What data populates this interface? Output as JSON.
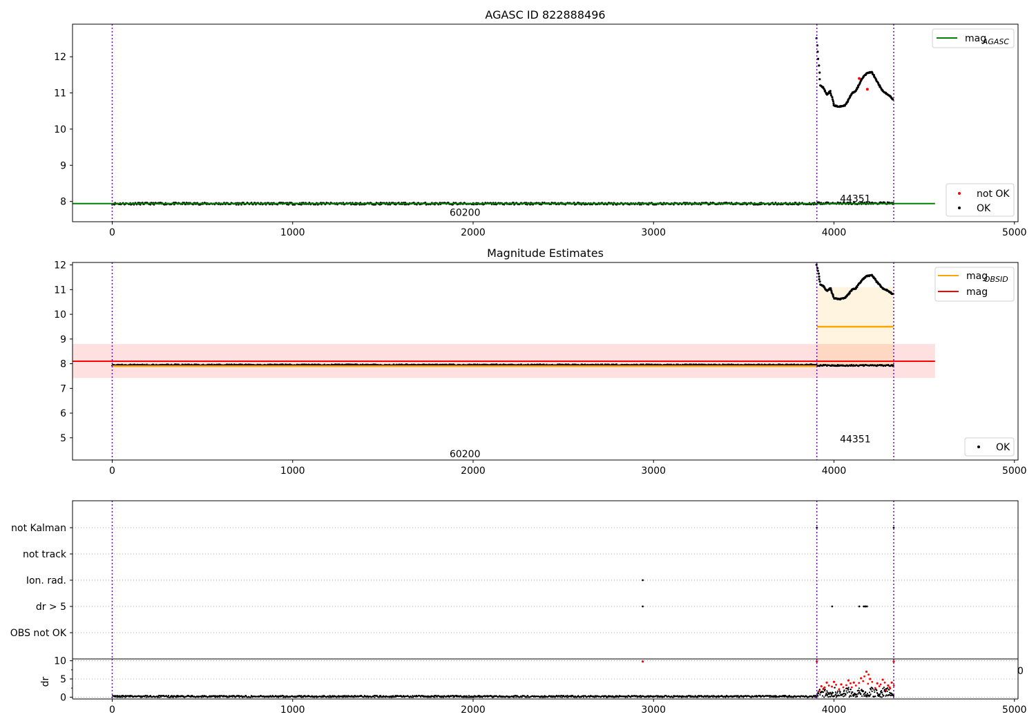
{
  "chart_data": [
    {
      "type": "scatter",
      "title": "AGASC ID 822888496",
      "xlim": [
        -220,
        5020
      ],
      "ylim": [
        7.44,
        12.9
      ],
      "x_ticks": [
        0,
        1000,
        2000,
        3000,
        4000,
        5000
      ],
      "y_ticks": [
        8,
        9,
        10,
        11,
        12
      ],
      "grid": false,
      "legend_upper": {
        "placement": "top-right",
        "entries": [
          {
            "label": "mag",
            "subscript": "AGASC",
            "color": "#008000"
          }
        ]
      },
      "legend_lower": {
        "placement": "bottom-right",
        "entries": [
          {
            "label": "not OK",
            "color": "#ff0000"
          },
          {
            "label": "OK",
            "color": "#000000"
          }
        ]
      },
      "reference_line": {
        "y": 7.94,
        "x_range": [
          -220,
          4560
        ],
        "color": "#008000"
      },
      "obsid_boundaries": [
        0,
        3905,
        4331
      ],
      "obsid_labels": [
        {
          "text": "60200",
          "x": 1955,
          "y": 7.7
        },
        {
          "text": "44351",
          "x": 4118,
          "y": 8.08
        }
      ],
      "series": [
        {
          "name": "OK",
          "color": "#000000",
          "segments": [
            {
              "x": [
                0,
                3905
              ],
              "y": 7.94
            },
            {
              "x": [
                3905,
                3925,
                3940,
                3960,
                3980,
                4000,
                4030,
                4060,
                4080,
                4100,
                4120,
                4150,
                4180,
                4210,
                4240,
                4270,
                4300,
                4331
              ],
              "y": [
                12.5,
                11.2,
                11.15,
                10.95,
                11.05,
                10.65,
                10.62,
                10.65,
                10.8,
                11.0,
                11.05,
                11.35,
                11.55,
                11.58,
                11.3,
                11.05,
                10.95,
                10.8
              ]
            },
            {
              "x": [
                3905,
                4331
              ],
              "y": 7.95
            }
          ]
        },
        {
          "name": "not OK",
          "color": "#ff0000",
          "points": [
            {
              "x": 4140,
              "y": 11.4
            },
            {
              "x": 4185,
              "y": 11.1
            }
          ]
        }
      ]
    },
    {
      "type": "scatter",
      "title": "Magnitude Estimates",
      "xlim": [
        -220,
        5020
      ],
      "ylim": [
        4.1,
        12.1
      ],
      "x_ticks": [
        0,
        1000,
        2000,
        3000,
        4000,
        5000
      ],
      "y_ticks": [
        5,
        6,
        7,
        8,
        9,
        10,
        11,
        12
      ],
      "grid": false,
      "legend_upper": {
        "placement": "top-right",
        "entries": [
          {
            "label": "mag",
            "subscript": "OBSID",
            "color": "#ffa500"
          },
          {
            "label": "mag",
            "subscript": "",
            "color": "#ff0000"
          }
        ]
      },
      "legend_lower": {
        "placement": "bottom-right",
        "entries": [
          {
            "label": "OK",
            "color": "#000000"
          }
        ]
      },
      "overall_mag": {
        "y": 8.1,
        "band": [
          7.42,
          8.8
        ],
        "x_range": [
          -220,
          4560
        ],
        "color": "#ff0000"
      },
      "obsid_mag": [
        {
          "x_range": [
            0,
            3905
          ],
          "y": 7.9
        },
        {
          "x_range": [
            3905,
            4331
          ],
          "y": 9.5,
          "band": [
            7.9,
            11.1
          ]
        }
      ],
      "obsid_boundaries": [
        0,
        3905,
        4331
      ],
      "obsid_labels": [
        {
          "text": "60200",
          "x": 1955,
          "y": 4.35
        },
        {
          "text": "44351",
          "x": 4118,
          "y": 4.95
        }
      ],
      "series": [
        {
          "name": "OK",
          "color": "#000000",
          "segments": [
            {
              "x": [
                0,
                3905
              ],
              "y": 7.95
            },
            {
              "x": [
                3905,
                3925,
                3940,
                3960,
                3980,
                4000,
                4030,
                4060,
                4080,
                4100,
                4120,
                4150,
                4180,
                4210,
                4240,
                4270,
                4300,
                4331
              ],
              "y": [
                12.0,
                11.2,
                11.15,
                10.95,
                11.05,
                10.65,
                10.62,
                10.65,
                10.8,
                11.0,
                11.05,
                11.35,
                11.55,
                11.58,
                11.3,
                11.05,
                10.95,
                10.8
              ]
            },
            {
              "x": [
                3905,
                4331
              ],
              "y": 7.93
            }
          ]
        }
      ]
    },
    {
      "type": "scatter",
      "xlim": [
        -220,
        5020
      ],
      "categories": [
        "not Kalman",
        "not track",
        "Ion. rad.",
        "dr > 5",
        "OBS not OK"
      ],
      "grid": true,
      "obsid_boundaries": [
        0,
        3905,
        4331
      ],
      "flag_points": [
        {
          "category": "not Kalman",
          "x": [
            3905,
            4331
          ]
        },
        {
          "category": "Ion. rad.",
          "x": [
            2940
          ]
        },
        {
          "category": "dr > 5",
          "x": [
            2940,
            3990,
            4140,
            4165,
            4175
          ]
        }
      ]
    },
    {
      "type": "scatter",
      "ylabel": "dr",
      "ylim": [
        -0.5,
        10.5
      ],
      "y_ticks": [
        0,
        5,
        10
      ],
      "x_ticks": [
        0,
        1000,
        2000,
        3000,
        4000,
        5000
      ],
      "xlim": [
        -220,
        5020
      ],
      "corner_label": "0",
      "grid": true,
      "obsid_boundaries": [
        0,
        3905,
        4331
      ],
      "series": [
        {
          "name": "OK",
          "color": "#000000",
          "baseline": 0.2,
          "x_range": [
            0,
            3905
          ]
        },
        {
          "name": "OK",
          "color": "#000000",
          "baseline": 1.0,
          "x_range": [
            3905,
            4331
          ]
        },
        {
          "name": "not OK",
          "color": "#ff0000",
          "points": [
            {
              "x": 2940,
              "y": 9.8
            },
            {
              "x": 3905,
              "y": 9.8
            },
            {
              "x": 4331,
              "y": 9.8
            },
            {
              "x": 3930,
              "y": 3.0
            },
            {
              "x": 3960,
              "y": 4.0
            },
            {
              "x": 4000,
              "y": 4.2
            },
            {
              "x": 4040,
              "y": 3.5
            },
            {
              "x": 4080,
              "y": 4.6
            },
            {
              "x": 4110,
              "y": 4.0
            },
            {
              "x": 4150,
              "y": 5.2
            },
            {
              "x": 4180,
              "y": 7.0
            },
            {
              "x": 4200,
              "y": 5.0
            },
            {
              "x": 4240,
              "y": 3.8
            },
            {
              "x": 4270,
              "y": 4.8
            },
            {
              "x": 4300,
              "y": 3.2
            },
            {
              "x": 4320,
              "y": 4.0
            }
          ]
        }
      ]
    }
  ]
}
